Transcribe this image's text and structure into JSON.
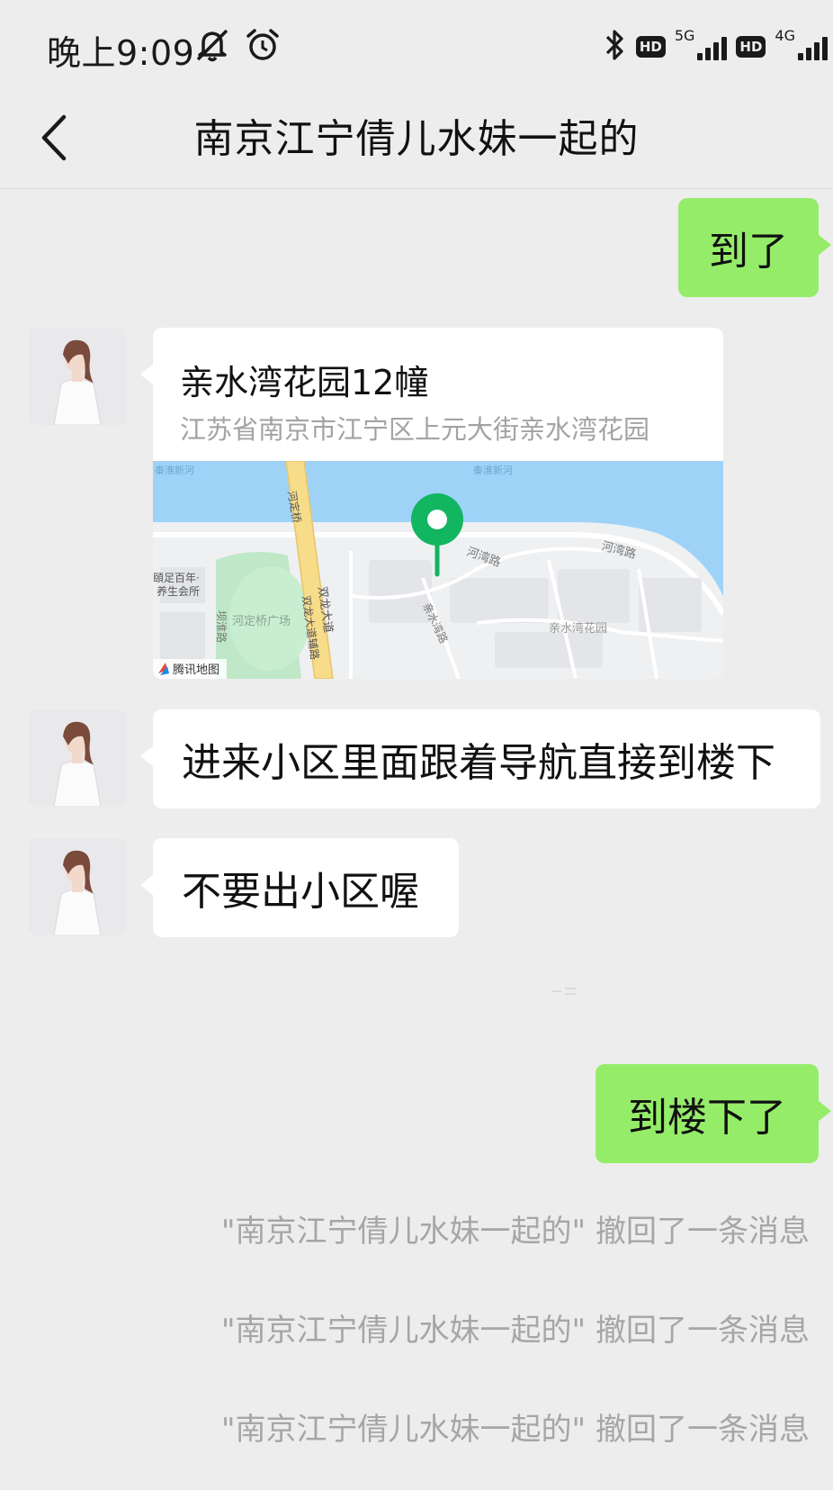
{
  "status_bar": {
    "time": "晚上9:09",
    "icons": [
      "bell-off-icon",
      "alarm-clock-icon",
      "bluetooth-icon"
    ],
    "network1": {
      "hd": "HD",
      "type": "5G"
    },
    "network2": {
      "hd": "HD",
      "type": "4G"
    }
  },
  "header": {
    "title": "南京江宁倩儿水妹一起的",
    "back_icon": "chevron-left-icon"
  },
  "messages": [
    {
      "id": "m1",
      "direction": "out",
      "text": "到了"
    },
    {
      "id": "m2",
      "direction": "in",
      "type": "location",
      "location_name": "亲水湾花园12幢",
      "location_address": "江苏省南京市江宁区上元大街亲水湾花园",
      "map_labels": {
        "river_left": "秦淮新河",
        "river_center": "秦淮新河",
        "bridge": "河定桥",
        "road_hewan1": "河湾路",
        "road_hewan2": "河湾路",
        "poi_wellness": "頤足百年·",
        "poi_wellness2": "养生会所",
        "plaza": "河定桥广场",
        "avenue": "双龙大道",
        "avenue_aux": "双龙大道辅路",
        "road_qinhuai": "坝淮路",
        "road_qinshui": "亲水湾路",
        "garden": "亲水湾花园",
        "provider": "腾讯地图"
      }
    },
    {
      "id": "m3",
      "direction": "in",
      "text": "进来小区里面跟着导航直接到楼下"
    },
    {
      "id": "m4",
      "direction": "in",
      "text": "不要出小区喔"
    },
    {
      "id": "m5",
      "direction": "out",
      "text": "到楼下了"
    }
  ],
  "recall_notices": [
    "\"南京江宁倩儿水妹一起的\" 撤回了一条消息",
    "\"南京江宁倩儿水妹一起的\" 撤回了一条消息",
    "\"南京江宁倩儿水妹一起的\" 撤回了一条消息"
  ],
  "colors": {
    "background": "#ededed",
    "outgoing_bubble": "#95ec69",
    "incoming_bubble": "#ffffff",
    "map_water": "#9ed3f7",
    "map_pin": "#12b560"
  }
}
